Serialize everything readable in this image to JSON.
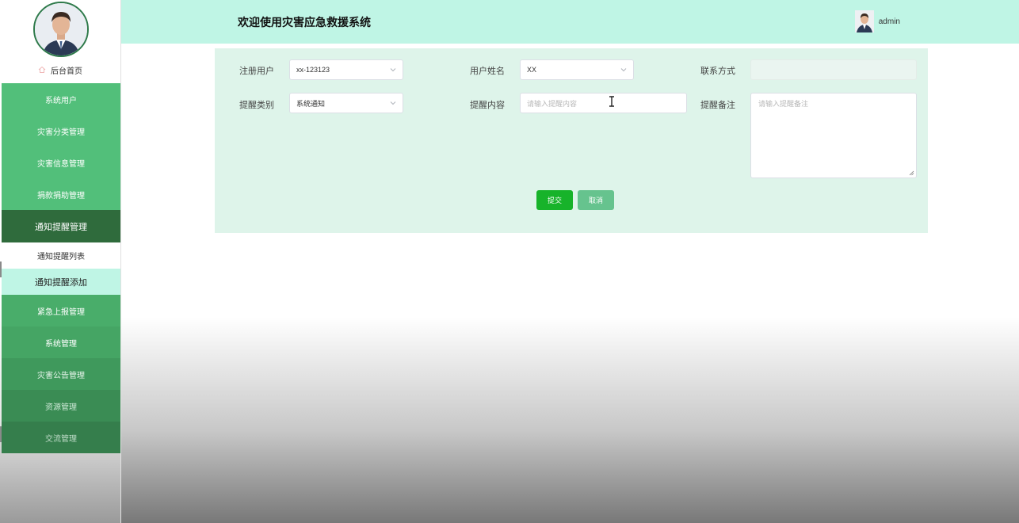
{
  "header": {
    "title": "欢迎使用灾害应急救援系统",
    "username": "admin"
  },
  "sidebar": {
    "home_label": "后台首页",
    "menu": [
      {
        "label": "系统用户"
      },
      {
        "label": "灾害分类管理"
      },
      {
        "label": "灾害信息管理"
      },
      {
        "label": "捐款捐助管理"
      },
      {
        "label": "通知提醒管理"
      }
    ],
    "submenu": [
      {
        "label": "通知提醒列表"
      },
      {
        "label": "通知提醒添加"
      }
    ],
    "menu_lower": [
      {
        "label": "紧急上报管理"
      },
      {
        "label": "系统管理"
      },
      {
        "label": "灾害公告管理"
      },
      {
        "label": "资源管理"
      },
      {
        "label": "交流管理"
      }
    ]
  },
  "form": {
    "registered_user": {
      "label": "注册用户",
      "value": "xx-123123"
    },
    "user_name": {
      "label": "用户姓名",
      "value": "XX"
    },
    "contact": {
      "label": "联系方式",
      "value": ""
    },
    "reminder_type": {
      "label": "提醒类别",
      "value": "系统通知"
    },
    "reminder_content": {
      "label": "提醒内容",
      "placeholder": "请输入提醒内容"
    },
    "reminder_note": {
      "label": "提醒备注",
      "placeholder": "请输入提醒备注"
    },
    "submit_label": "提交",
    "cancel_label": "取消"
  },
  "colors": {
    "header_bg": "#bff5e5",
    "menu_bg": "#52bf7a",
    "menu_active_bg": "#2f6b3c",
    "panel_bg": "#def4ea",
    "submit_bg": "#17b32a",
    "cancel_bg": "#66c38e"
  },
  "icons": [
    "home-icon",
    "chevron-down-icon",
    "text-cursor-icon"
  ]
}
